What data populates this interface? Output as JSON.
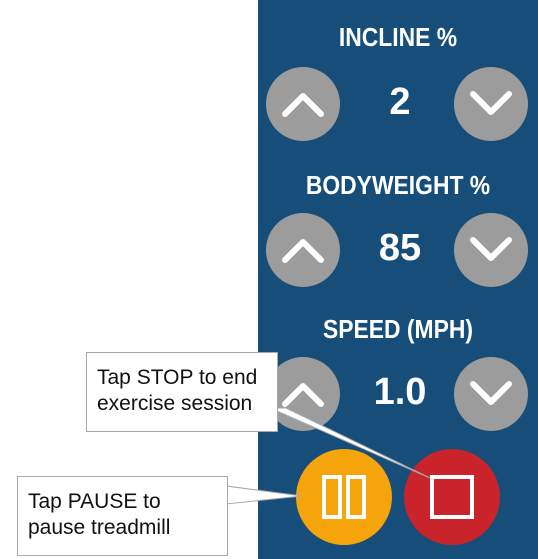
{
  "controls": {
    "incline": {
      "label": "INCLINE %",
      "value": "2"
    },
    "bodyweight": {
      "label": "BODYWEIGHT %",
      "value": "85"
    },
    "speed": {
      "label": "SPEED (MPH)",
      "value": "1.0"
    }
  },
  "callouts": {
    "stop": {
      "line1": "Tap STOP to end",
      "line2": "exercise session"
    },
    "pause": {
      "line1": "Tap PAUSE to",
      "line2": "pause treadmill"
    }
  },
  "colors": {
    "panel": "#164e79",
    "arrow_button": "#9c9c9c",
    "pause": "#f5a40b",
    "stop": "#c9232b"
  },
  "icons": [
    "chevron-up-icon",
    "chevron-down-icon",
    "pause-icon",
    "stop-icon"
  ]
}
